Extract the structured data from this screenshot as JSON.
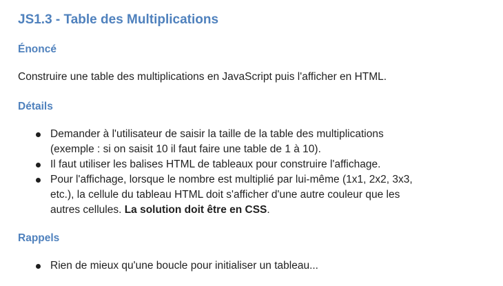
{
  "title": "JS1.3 - Table des Multiplications",
  "sections": {
    "enonce": {
      "heading": "Énoncé",
      "text": "Construire une table des multiplications en JavaScript puis l'afficher en HTML."
    },
    "details": {
      "heading": "Détails",
      "items": [
        {
          "lines": [
            "Demander à l'utilisateur de saisir la taille de la table des multiplications",
            "(exemple : si on saisit 10 il faut faire une table de 1 à 10)."
          ]
        },
        {
          "lines": [
            "Il faut utiliser les balises HTML de tableaux pour construire l'affichage."
          ]
        },
        {
          "lines": [
            "Pour l'affichage, lorsque le nombre est multiplié par lui-même (1x1, 2x2, 3x3,",
            "etc.), la cellule du tableau HTML doit s'afficher d'une autre couleur que les"
          ],
          "last_line_prefix": "autres cellules. ",
          "last_line_bold": "La solution doit être en CSS",
          "last_line_suffix": "."
        }
      ]
    },
    "rappels": {
      "heading": "Rappels",
      "items": [
        {
          "lines": [
            "Rien de mieux qu'une boucle pour initialiser un tableau..."
          ]
        }
      ]
    }
  },
  "colors": {
    "heading": "#4f81bd",
    "text": "#1f1f1f"
  }
}
